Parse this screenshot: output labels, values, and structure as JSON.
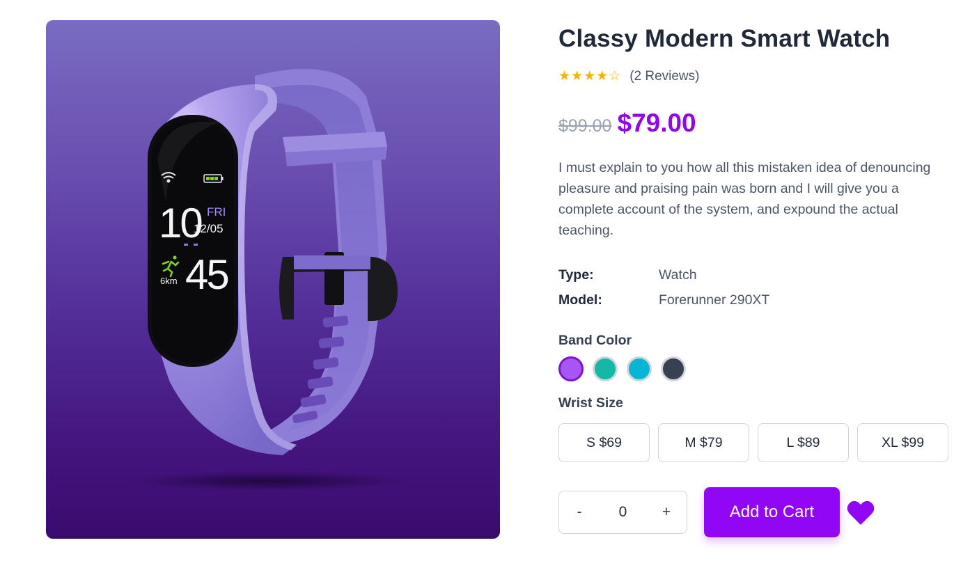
{
  "product": {
    "title": "Classy Modern Smart Watch",
    "rating": 4,
    "rating_max": 5,
    "stars": {
      "filled": "★★★★",
      "empty": "☆"
    },
    "reviews_text": "(2 Reviews)",
    "old_price": "$99.00",
    "price": "$79.00",
    "description": "I must explain to you how all this mistaken idea of denouncing pleasure and praising pain was born and I will give you a complete account of the system, and expound the actual teaching.",
    "specs": {
      "type_label": "Type:",
      "type_value": "Watch",
      "model_label": "Model:",
      "model_value": "Forerunner 290XT"
    }
  },
  "image": {
    "screen_time_hour": "10",
    "screen_day": "FRI",
    "screen_date": "12/05",
    "screen_distance": "6km",
    "screen_value": "45"
  },
  "band_color": {
    "label": "Band Color",
    "options": [
      {
        "color": "#a855f7",
        "selected": true
      },
      {
        "color": "#14b8a6",
        "selected": false
      },
      {
        "color": "#06b6d4",
        "selected": false
      },
      {
        "color": "#374151",
        "selected": false
      }
    ]
  },
  "wrist_size": {
    "label": "Wrist Size",
    "options": [
      "S $69",
      "M $79",
      "L $89",
      "XL $99"
    ]
  },
  "cart": {
    "minus_label": "-",
    "quantity": "0",
    "plus_label": "+",
    "add_label": "Add to Cart"
  },
  "colors": {
    "accent": "#9106f5",
    "price": "#9106e8",
    "star": "#f5b400",
    "wishlist": "#9106f5"
  },
  "icons": {
    "wishlist": "heart-icon",
    "wifi": "wifi-icon",
    "battery": "battery-icon",
    "runner": "runner-icon"
  }
}
